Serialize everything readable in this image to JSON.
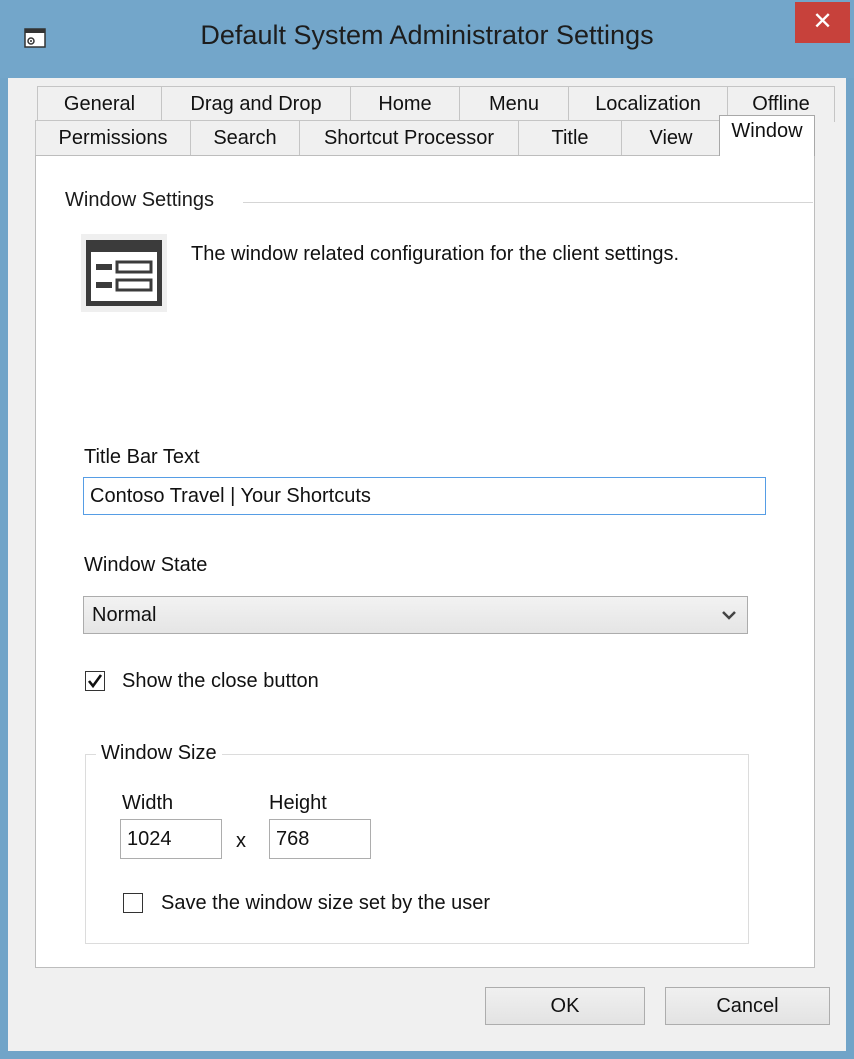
{
  "window": {
    "title": "Default System Administrator Settings",
    "close_glyph": "✕"
  },
  "tabs": {
    "row1": [
      "General",
      "Drag and Drop",
      "Home",
      "Menu",
      "Localization",
      "Offline"
    ],
    "row2": [
      "Permissions",
      "Search",
      "Shortcut Processor",
      "Title",
      "View"
    ],
    "selected": "Window"
  },
  "panel": {
    "section_title": "Window Settings",
    "description": "The window related configuration for the client settings.",
    "title_bar_label": "Title Bar Text",
    "title_bar_value": "Contoso Travel | Your Shortcuts",
    "window_state_label": "Window State",
    "window_state_value": "Normal",
    "show_close_label": "Show the close button",
    "show_close_checked": true,
    "window_size_group": "Window Size",
    "width_label": "Width",
    "height_label": "Height",
    "width_value": "1024",
    "height_value": "768",
    "times_sign": "x",
    "save_size_label": "Save the window size set by the user",
    "save_size_checked": false
  },
  "buttons": {
    "ok": "OK",
    "cancel": "Cancel"
  },
  "icons": {
    "app": "settings-window-icon",
    "section": "window-settings-icon",
    "close": "close-icon",
    "dropdown": "chevron-down-icon",
    "check": "checkmark-icon"
  },
  "colors": {
    "titlebar": "#73a6ca",
    "close": "#c7413b",
    "focus_border": "#569de5"
  }
}
